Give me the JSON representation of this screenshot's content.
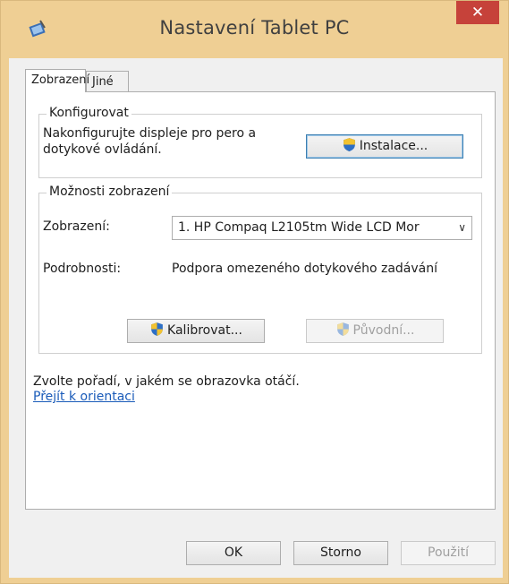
{
  "window": {
    "title": "Nastavení Tablet PC",
    "close_glyph": "✕"
  },
  "tabs": [
    {
      "label": "Zobrazení",
      "active": true
    },
    {
      "label": "Jiné",
      "active": false
    }
  ],
  "configure_group": {
    "title": "Konfigurovat",
    "description_line1": "Nakonfigurujte displeje pro pero a",
    "description_line2": "dotykové ovládání.",
    "setup_button": "Instalace..."
  },
  "display_options": {
    "title": "Možnosti zobrazení",
    "display_label": "Zobrazení:",
    "display_value": "1. HP Compaq L2105tm Wide LCD Mor",
    "details_label": "Podrobnosti:",
    "details_value": "Podpora omezeného dotykového zadávání",
    "calibrate_button": "Kalibrovat...",
    "reset_button": "Původní..."
  },
  "orientation": {
    "text": "Zvolte pořadí, v jakém se obrazovka otáčí.",
    "link": "Přejít k orientaci"
  },
  "footer": {
    "ok": "OK",
    "cancel": "Storno",
    "apply": "Použití"
  },
  "colors": {
    "frame": "#efcf94",
    "close": "#c6423a",
    "link": "#1a5bb9"
  }
}
